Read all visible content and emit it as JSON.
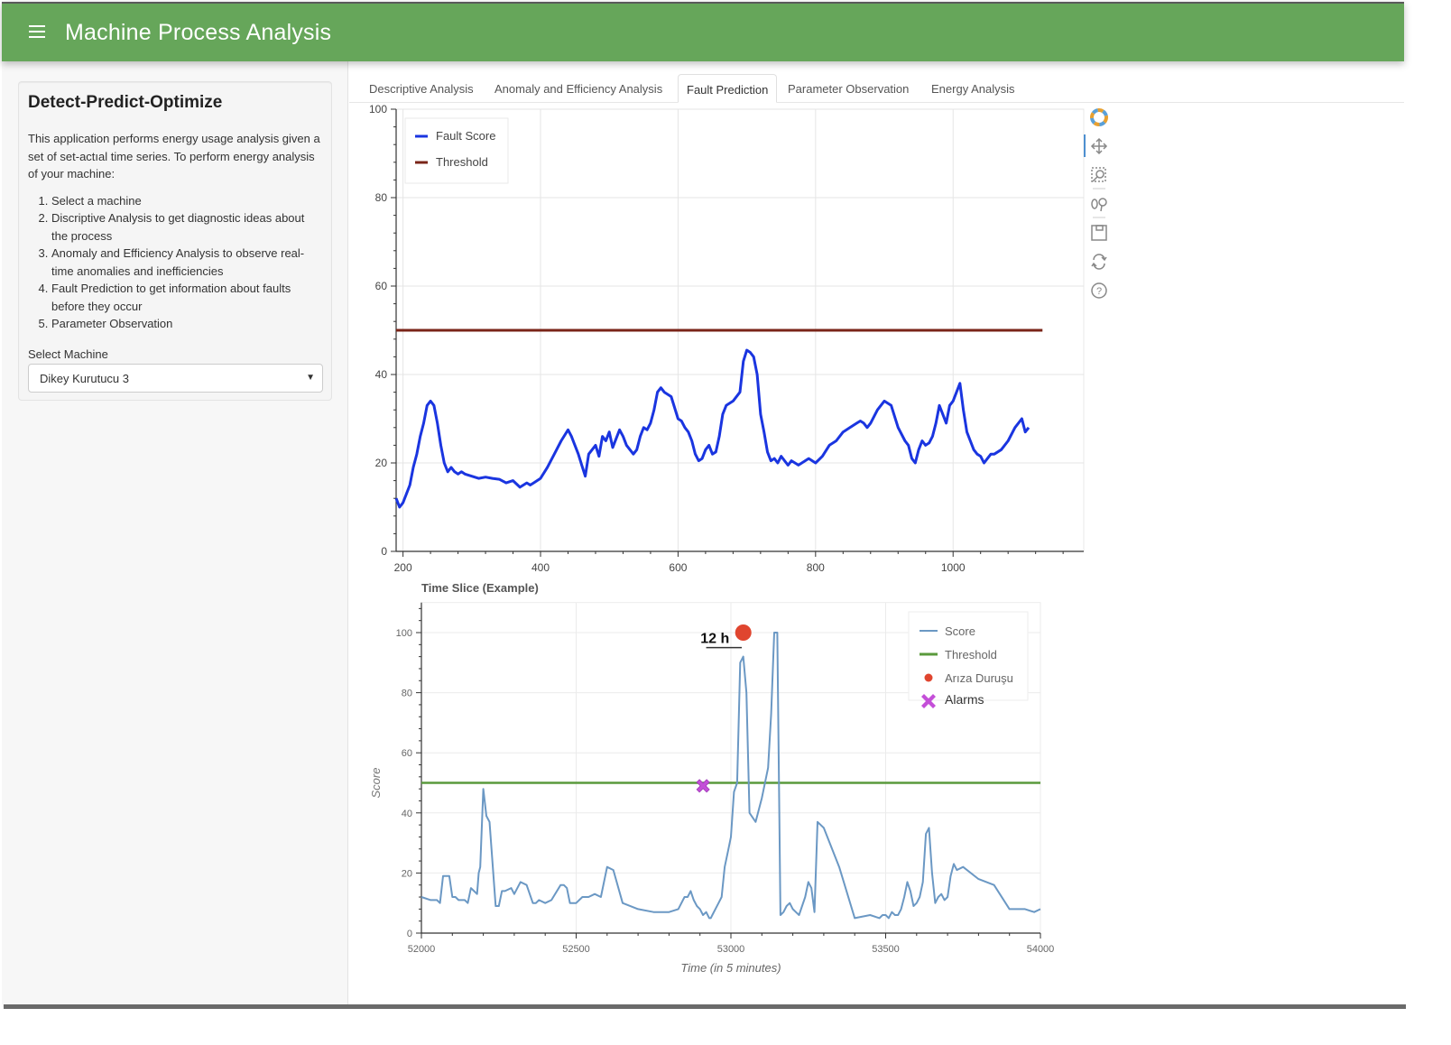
{
  "app": {
    "title": "Machine Process Analysis",
    "menu_icon": "hamburger-menu-icon"
  },
  "sidebar": {
    "heading": "Detect-Predict-Optimize",
    "description": "This application performs energy usage analysis given a set of set-actıal time series. To perform energy analysis of your machine:",
    "steps": [
      "Select a machine",
      "Discriptive Analysis to get diagnostic ideas about the process",
      "Anomaly and Efficiency Analysis to observe real-time anomalies and inefficiencies",
      "Fault Prediction to get information about faults before they occur",
      "Parameter Observation"
    ],
    "select_label": "Select Machine",
    "select_value": "Dikey Kurutucu 3"
  },
  "tabs": [
    {
      "label": "Descriptive Analysis",
      "active": false
    },
    {
      "label": "Anomaly and Efficiency Analysis",
      "active": false
    },
    {
      "label": "Fault Prediction",
      "active": true
    },
    {
      "label": "Parameter Observation",
      "active": false
    },
    {
      "label": "Energy Analysis",
      "active": false
    }
  ],
  "plot_toolbar": {
    "tools": [
      "bokeh-logo-icon",
      "pan-icon",
      "box-zoom-icon",
      "wheel-zoom-icon",
      "save-icon",
      "reset-icon",
      "help-icon"
    ],
    "active_tool": "pan-icon"
  },
  "colors": {
    "header_green": "#66a65a",
    "fault_score": "#1a35e0",
    "threshold_top": "#7a2418",
    "score_bottom": "#6b98c4",
    "threshold_bottom": "#5a9a3c",
    "fault_marker": "#e0452f",
    "alarm_marker": "#c44fd8"
  },
  "chart_data": [
    {
      "type": "line",
      "title": "",
      "xlabel": "",
      "ylabel": "",
      "xlim": [
        190,
        1190
      ],
      "ylim": [
        0,
        100
      ],
      "xticks": [
        200,
        400,
        600,
        800,
        1000
      ],
      "yticks": [
        0,
        20,
        40,
        60,
        80,
        100
      ],
      "grid": true,
      "legend_position": "top-left",
      "series": [
        {
          "name": "Fault Score",
          "x": [
            190,
            195,
            200,
            205,
            210,
            215,
            220,
            225,
            230,
            235,
            240,
            245,
            250,
            255,
            260,
            265,
            270,
            275,
            280,
            285,
            290,
            300,
            310,
            320,
            330,
            340,
            350,
            360,
            370,
            380,
            385,
            390,
            400,
            410,
            420,
            430,
            440,
            445,
            450,
            455,
            460,
            465,
            470,
            475,
            480,
            485,
            490,
            495,
            500,
            505,
            510,
            515,
            520,
            525,
            530,
            535,
            540,
            545,
            550,
            555,
            560,
            565,
            570,
            575,
            580,
            590,
            600,
            605,
            610,
            615,
            620,
            625,
            630,
            635,
            640,
            645,
            650,
            655,
            660,
            665,
            670,
            680,
            690,
            695,
            700,
            705,
            710,
            715,
            720,
            725,
            730,
            735,
            740,
            745,
            750,
            755,
            760,
            765,
            770,
            775,
            780,
            790,
            800,
            810,
            820,
            830,
            840,
            850,
            860,
            865,
            870,
            875,
            880,
            890,
            900,
            910,
            920,
            930,
            935,
            940,
            945,
            950,
            955,
            960,
            965,
            970,
            975,
            980,
            985,
            990,
            995,
            1000,
            1005,
            1010,
            1015,
            1020,
            1025,
            1030,
            1035,
            1040,
            1045,
            1050,
            1055,
            1060,
            1070,
            1080,
            1090,
            1100,
            1105,
            1110,
            1115,
            1120,
            1125,
            1130
          ],
          "y": [
            12,
            10,
            11,
            13,
            15,
            19,
            22,
            26,
            29,
            33,
            34,
            33,
            29,
            24,
            20,
            18,
            19,
            18,
            17.5,
            18,
            17.5,
            17,
            16.5,
            16.8,
            16.5,
            16.3,
            15.5,
            16,
            14.5,
            15.5,
            15,
            15.5,
            16.5,
            19,
            22,
            25,
            27.5,
            26,
            24,
            22,
            19.5,
            17,
            22,
            23,
            24,
            21.5,
            26,
            25,
            27,
            23.5,
            25.5,
            27.5,
            26,
            24,
            23,
            22,
            23,
            26,
            28,
            27.5,
            29,
            32,
            36,
            37,
            36,
            35,
            30,
            29.5,
            28,
            27,
            25,
            22,
            20.5,
            21,
            23,
            24,
            22,
            22.5,
            26,
            31,
            33,
            34,
            36,
            43,
            45.5,
            45,
            44,
            40,
            31,
            27,
            22.5,
            20.5,
            21,
            20,
            21.5,
            20.5,
            19.5,
            20.5,
            20,
            19.5,
            20,
            21,
            20,
            21.5,
            24,
            25,
            27,
            28,
            29,
            29.5,
            29,
            28,
            29,
            32,
            34,
            33,
            28,
            25,
            24,
            21,
            20,
            23,
            25,
            24,
            24.5,
            26,
            29,
            33,
            31,
            29,
            33,
            34,
            36,
            38,
            32,
            27,
            25,
            23,
            22,
            21.5,
            20,
            21,
            22,
            22,
            23,
            25,
            28,
            30,
            27,
            28
          ]
        },
        {
          "name": "Threshold",
          "x": [
            190,
            1130
          ],
          "y": [
            50,
            50
          ]
        }
      ]
    },
    {
      "type": "line",
      "title": "Time Slice (Example)",
      "xlabel": "Time (in 5 minutes)",
      "ylabel": "Score",
      "xlim": [
        52000,
        54000
      ],
      "ylim": [
        0,
        110
      ],
      "xticks": [
        52000,
        52500,
        53000,
        53500,
        54000
      ],
      "yticks": [
        0,
        20,
        40,
        60,
        80,
        100
      ],
      "grid": true,
      "legend_position": "top-right",
      "annotations": [
        {
          "text": "12 h",
          "x": 52960,
          "y": 98
        }
      ],
      "series": [
        {
          "name": "Score",
          "x": [
            52000,
            52030,
            52050,
            52060,
            52070,
            52090,
            52100,
            52110,
            52120,
            52140,
            52150,
            52160,
            52170,
            52180,
            52185,
            52190,
            52200,
            52210,
            52220,
            52240,
            52250,
            52260,
            52270,
            52290,
            52300,
            52320,
            52340,
            52360,
            52370,
            52380,
            52400,
            52420,
            52450,
            52460,
            52470,
            52480,
            52500,
            52520,
            52540,
            52560,
            52580,
            52600,
            52620,
            52650,
            52700,
            52750,
            52800,
            52830,
            52850,
            52860,
            52870,
            52880,
            52890,
            52900,
            52910,
            52920,
            52930,
            52935,
            52940,
            52950,
            52960,
            52970,
            52980,
            52990,
            53000,
            53010,
            53020,
            53030,
            53040,
            53050,
            53060,
            53080,
            53100,
            53120,
            53130,
            53140,
            53150,
            53160,
            53170,
            53180,
            53190,
            53200,
            53210,
            53220,
            53230,
            53240,
            53250,
            53260,
            53270,
            53280,
            53300,
            53350,
            53400,
            53450,
            53480,
            53490,
            53500,
            53510,
            53520,
            53530,
            53540,
            53550,
            53560,
            53570,
            53580,
            53590,
            53600,
            53610,
            53620,
            53630,
            53640,
            53650,
            53660,
            53670,
            53680,
            53690,
            53700,
            53710,
            53720,
            53730,
            53750,
            53800,
            53850,
            53900,
            53950,
            53980,
            54000
          ],
          "y": [
            12,
            11,
            11,
            10,
            19,
            19,
            12,
            12,
            11,
            11,
            10,
            15,
            14,
            13,
            20,
            22,
            48,
            39,
            37,
            9,
            9,
            14,
            14,
            15,
            13,
            17,
            16,
            10,
            10,
            11,
            10,
            11,
            16,
            16,
            15,
            10,
            10,
            12,
            12,
            13,
            12,
            22,
            21,
            10,
            8,
            7,
            7,
            8,
            12,
            12,
            14,
            11,
            9,
            8,
            6,
            7,
            5,
            5,
            6,
            8,
            10,
            12,
            22,
            27,
            32,
            47,
            50,
            90,
            92,
            80,
            40,
            37,
            45,
            55,
            73,
            100,
            100,
            6,
            7,
            9,
            10,
            8,
            7,
            6,
            9,
            12,
            17,
            15,
            7,
            37,
            35,
            22,
            5,
            6,
            5,
            6,
            6,
            5,
            7,
            6,
            6,
            8,
            12,
            17,
            14,
            9,
            10,
            12,
            17,
            33,
            35,
            20,
            10,
            12,
            13,
            11,
            12,
            19,
            23,
            21,
            22,
            18,
            16,
            8,
            8,
            7,
            8,
            6,
            6,
            7,
            8,
            6,
            6,
            8
          ],
          "note": "values approximated from plot"
        },
        {
          "name": "Threshold",
          "x": [
            52000,
            54000
          ],
          "y": [
            50,
            50
          ]
        },
        {
          "name": "Arıza Duruşu",
          "marker": "circle",
          "x": [
            53040
          ],
          "y": [
            100
          ]
        },
        {
          "name": "Alarms",
          "marker": "x",
          "x": [
            52910
          ],
          "y": [
            49
          ]
        }
      ]
    }
  ]
}
